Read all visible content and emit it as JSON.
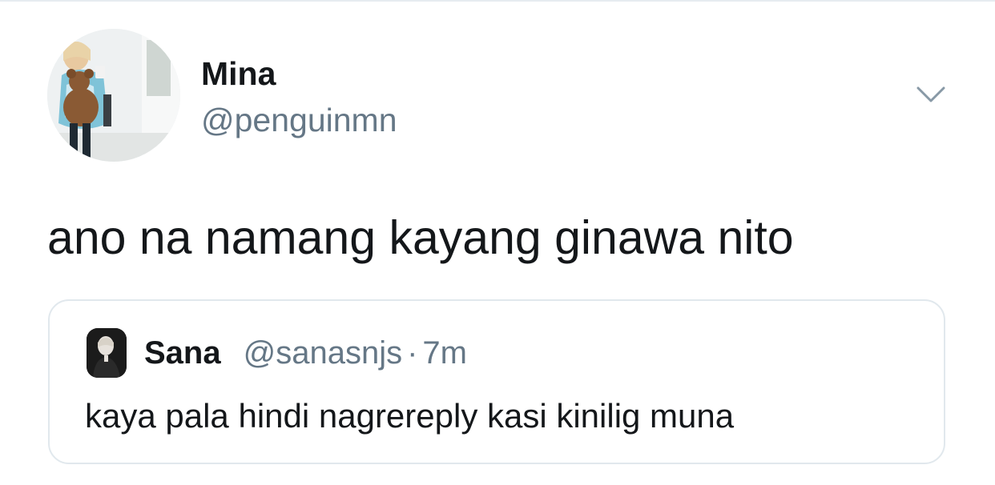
{
  "tweet": {
    "author": {
      "display_name": "Mina",
      "handle": "@penguinmn",
      "avatar_icon": "profile-photo"
    },
    "text": "ano na namang kayang ginawa nito",
    "menu_icon": "chevron-down-icon",
    "quoted_tweet": {
      "author": {
        "display_name": "Sana",
        "handle": "@sanasnjs",
        "avatar_icon": "profile-photo"
      },
      "separator": "·",
      "timestamp": "7m",
      "text": "kaya pala hindi nagrereply kasi kinilig muna"
    }
  },
  "colors": {
    "primary_text": "#14171a",
    "secondary_text": "#657786",
    "border": "#e1e8ed",
    "background": "#ffffff"
  }
}
